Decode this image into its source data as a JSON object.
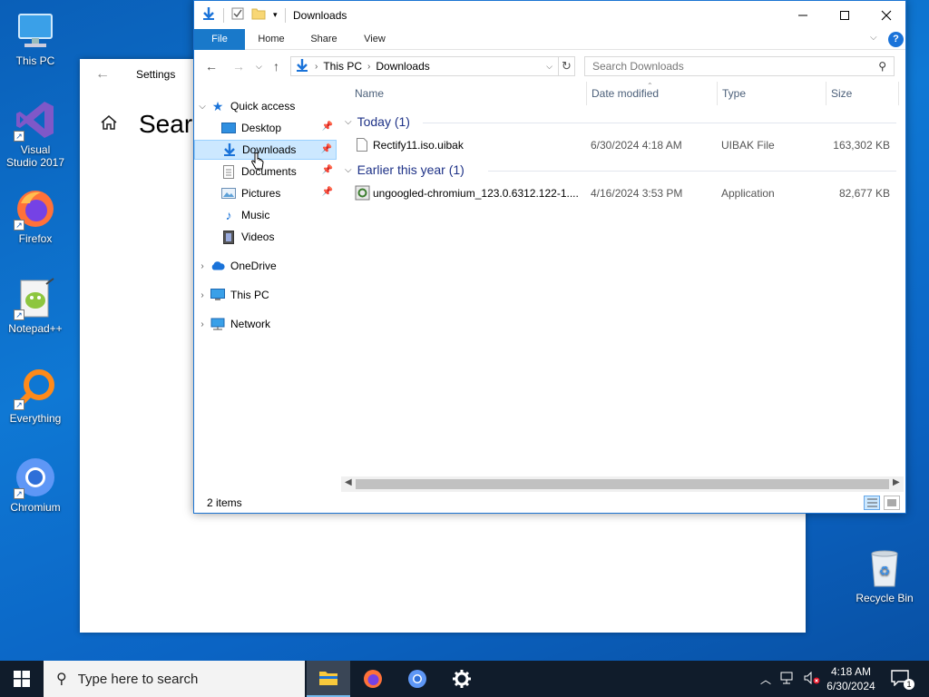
{
  "desktop": {
    "icons": [
      {
        "label": "This PC"
      },
      {
        "label": "Visual Studio 2017"
      },
      {
        "label": "Firefox"
      },
      {
        "label": "Notepad++"
      },
      {
        "label": "Everything"
      },
      {
        "label": "Chromium"
      },
      {
        "label": "Recycle Bin"
      }
    ]
  },
  "settings": {
    "title": "Settings",
    "heading": "Searc"
  },
  "explorer": {
    "title": "Downloads",
    "ribbon_tabs": [
      "File",
      "Home",
      "Share",
      "View"
    ],
    "breadcrumb": [
      "This PC",
      "Downloads"
    ],
    "search_placeholder": "Search Downloads",
    "nav": {
      "quick_access": "Quick access",
      "items": [
        "Desktop",
        "Downloads",
        "Documents",
        "Pictures",
        "Music",
        "Videos"
      ],
      "onedrive": "OneDrive",
      "this_pc": "This PC",
      "network": "Network"
    },
    "columns": [
      "Name",
      "Date modified",
      "Type",
      "Size"
    ],
    "groups": [
      {
        "label": "Today (1)",
        "files": [
          {
            "name": "Rectify11.iso.uibak",
            "date": "6/30/2024 4:18 AM",
            "type": "UIBAK File",
            "size": "163,302 KB"
          }
        ]
      },
      {
        "label": "Earlier this year (1)",
        "files": [
          {
            "name": "ungoogled-chromium_123.0.6312.122-1....",
            "date": "4/16/2024 3:53 PM",
            "type": "Application",
            "size": "82,677 KB"
          }
        ]
      }
    ],
    "status": "2 items"
  },
  "taskbar": {
    "search_placeholder": "Type here to search",
    "time": "4:18 AM",
    "date": "6/30/2024",
    "notification_count": "1"
  },
  "colors": {
    "accent": "#1979ca",
    "selection": "#cce8ff",
    "group_text": "#1e3287",
    "taskbar": "#101c2b"
  }
}
